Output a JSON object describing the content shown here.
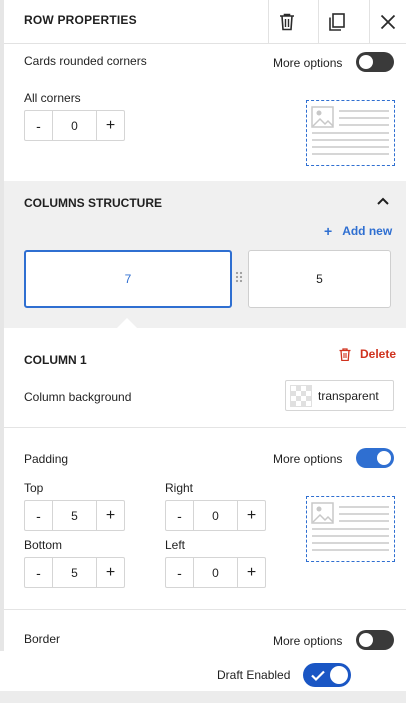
{
  "header": {
    "title": "ROW PROPERTIES",
    "delete_icon": "trash-icon",
    "duplicate_icon": "copy-icon",
    "close_icon": "close-icon"
  },
  "rounded": {
    "label": "Cards rounded corners",
    "more_options_label": "More options",
    "more_options_on": false,
    "all_corners_label": "All corners",
    "all_corners_value": "0",
    "minus": "-",
    "plus": "+"
  },
  "columns_structure": {
    "title": "COLUMNS STRUCTURE",
    "collapse_icon": "chevron-up-icon",
    "add_new_icon": "+",
    "add_new_label": "Add new",
    "columns": [
      "7",
      "5"
    ],
    "selected_index": 0
  },
  "column": {
    "title": "COLUMN 1",
    "delete_label": "Delete",
    "background_label": "Column background",
    "background_value": "transparent"
  },
  "padding": {
    "label": "Padding",
    "more_options_label": "More options",
    "more_options_on": true,
    "top_label": "Top",
    "top_value": "5",
    "right_label": "Right",
    "right_value": "0",
    "bottom_label": "Bottom",
    "bottom_value": "5",
    "left_label": "Left",
    "left_value": "0",
    "minus": "-",
    "plus": "+"
  },
  "border": {
    "label": "Border",
    "more_options_label": "More options",
    "more_options_on": false
  },
  "footer": {
    "draft_label": "Draft Enabled",
    "draft_on": true
  },
  "colors": {
    "accent": "#2f6fd1",
    "danger": "#d0321e",
    "toggle_off": "#3a3a3a",
    "draft_toggle": "#1a56c4"
  }
}
